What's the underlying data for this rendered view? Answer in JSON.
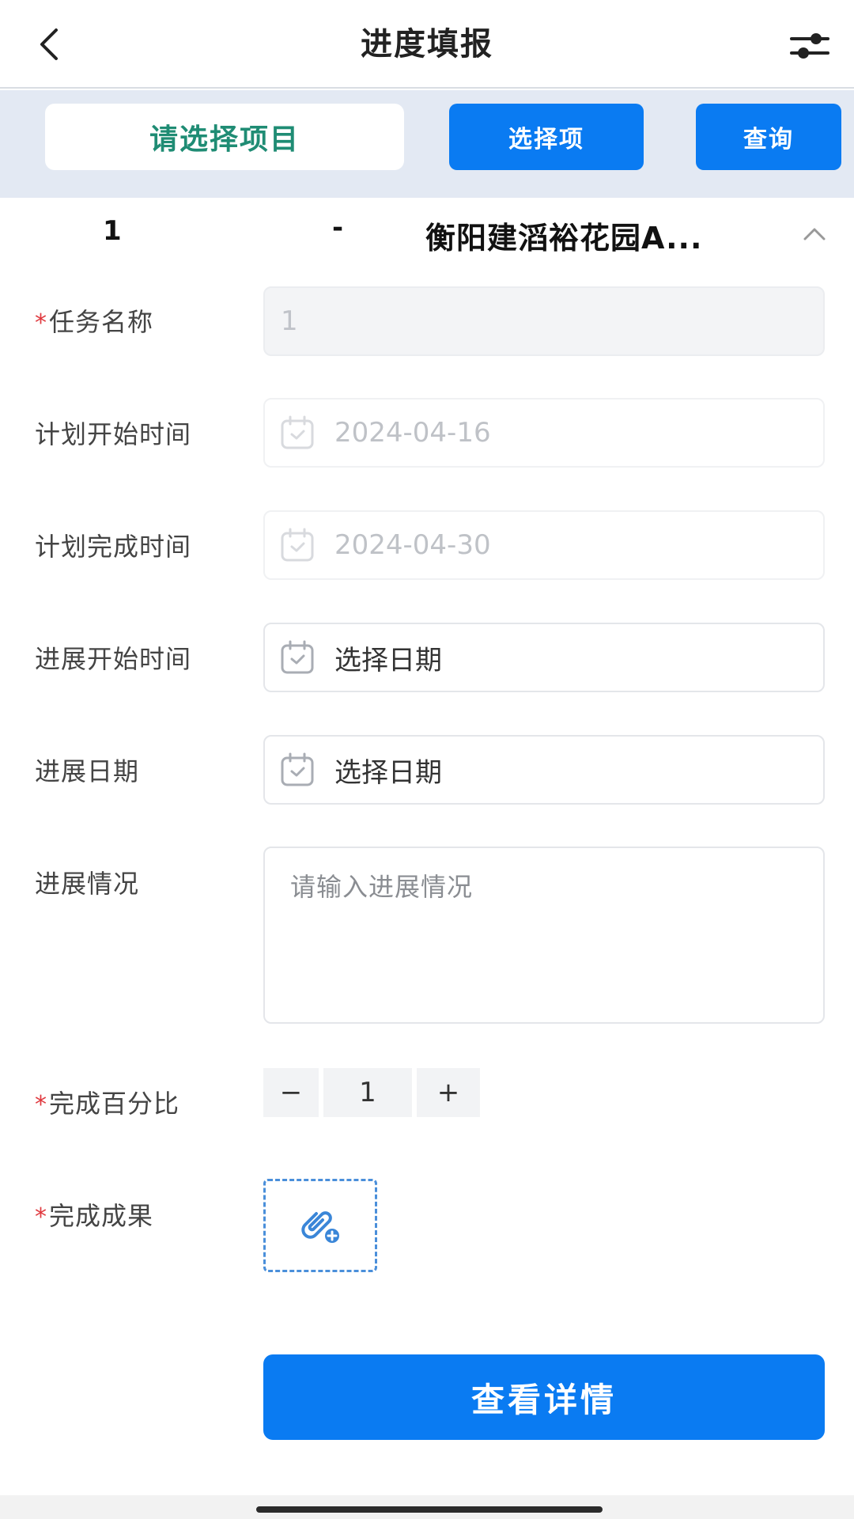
{
  "header": {
    "title": "进度填报",
    "back_icon": "chevron-left-icon",
    "filter_icon": "sliders-icon"
  },
  "search": {
    "project_placeholder": "请选择项目",
    "select_button": "选择项",
    "query_button": "查询"
  },
  "task_row": {
    "number": "1",
    "separator": "-",
    "project_name": "衡阳建滔裕花园A...",
    "toggle_icon": "chevron-up-icon"
  },
  "form": {
    "task_name": {
      "label": "任务名称",
      "required": "*",
      "value": "1"
    },
    "plan_start": {
      "label": "计划开始时间",
      "value": "2024-04-16"
    },
    "plan_end": {
      "label": "计划完成时间",
      "value": "2024-04-30"
    },
    "progress_start": {
      "label": "进展开始时间",
      "placeholder": "选择日期"
    },
    "progress_date": {
      "label": "进展日期",
      "placeholder": "选择日期"
    },
    "progress_status": {
      "label": "进展情况",
      "placeholder": "请输入进展情况"
    },
    "percent": {
      "label": "完成百分比",
      "required": "*",
      "value": "1",
      "minus": "−",
      "plus": "+"
    },
    "result": {
      "label": "完成成果",
      "required": "*",
      "upload_icon": "paperclip-add-icon"
    }
  },
  "actions": {
    "detail_button": "查看详情"
  },
  "colors": {
    "primary": "#0a7bf2",
    "project_text": "#1f8c74",
    "required": "#e0383e",
    "searchbar_bg": "#e3e9f3"
  }
}
